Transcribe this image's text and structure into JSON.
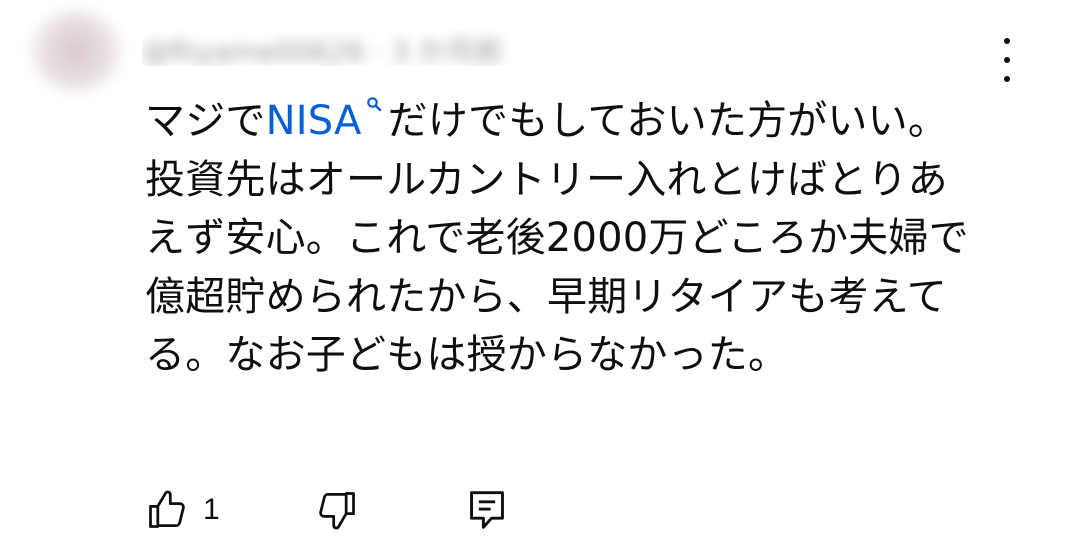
{
  "comment": {
    "author_blurred": "@Riyame00626 · 3 か月前",
    "text_before_link": "マジで",
    "search_link_text": "NISA",
    "text_after_link": "だけでもしておいた方がいい。",
    "lines": [
      "投資先はオールカントリー入れとけばとりあ",
      "えず安心。これで老後2000万どころか夫婦で",
      "億超貯められたから、早期リタイアも考えて",
      "る。なお子どもは授からなかった。"
    ]
  },
  "actions": {
    "like_count": "1"
  },
  "icons": {
    "avatar": "avatar",
    "menu": "kebab-menu-icon",
    "search": "search-icon",
    "like": "thumbs-up-icon",
    "dislike": "thumbs-down-icon",
    "reply": "reply-comment-icon"
  },
  "colors": {
    "text": "#0f0f0f",
    "link": "#065fd4",
    "background": "#ffffff"
  }
}
